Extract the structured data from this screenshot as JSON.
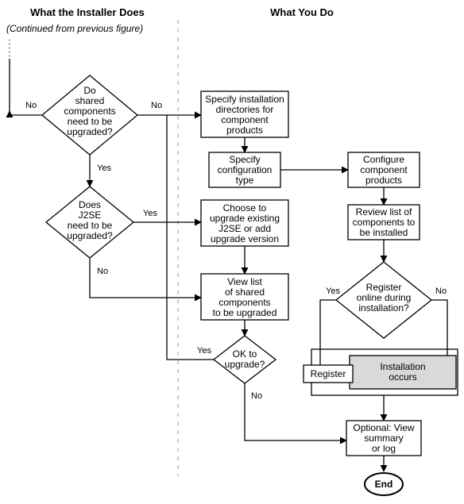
{
  "headers": {
    "left": "What the Installer Does",
    "right": "What You Do"
  },
  "continued": "(Continued from previous figure)",
  "nodes": {
    "d1": "Do\nshared\ncomponents\nneed to be\nupgraded?",
    "d2": "Does\nJ2SE\nneed to be\nupgraded?",
    "d3": "OK to\nupgrade?",
    "d4": "Register\nonline during\ninstallation?",
    "b1": "Specify installation\ndirectories for\ncomponent\nproducts",
    "b2": "Specify\nconfiguration\ntype",
    "b3": "Configure\ncomponent\nproducts",
    "b4": "Review list of\ncomponents to\nbe installed",
    "b5": "Choose to\nupgrade existing\nJ2SE or add\nupgrade version",
    "b6": "View list\nof shared\ncomponents\nto be upgraded",
    "b7": "Register",
    "b8": "Installation\noccurs",
    "b9": "Optional: View\nsummary\nor log",
    "end": "End"
  },
  "edges": {
    "yes": "Yes",
    "no": "No"
  }
}
